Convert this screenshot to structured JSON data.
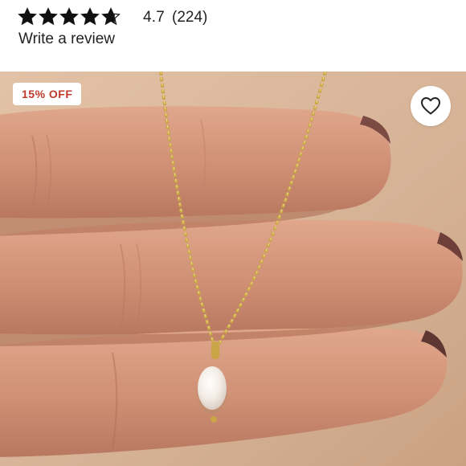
{
  "rating": {
    "value": "4.7",
    "count": "(224)",
    "stars_filled": 4.7,
    "star_color": "#111111",
    "write_review_label": "Write a review"
  },
  "product_image": {
    "badge_label": "15% OFF",
    "badge_color": "#c0392b",
    "favorite_icon": "heart-outline-icon"
  }
}
